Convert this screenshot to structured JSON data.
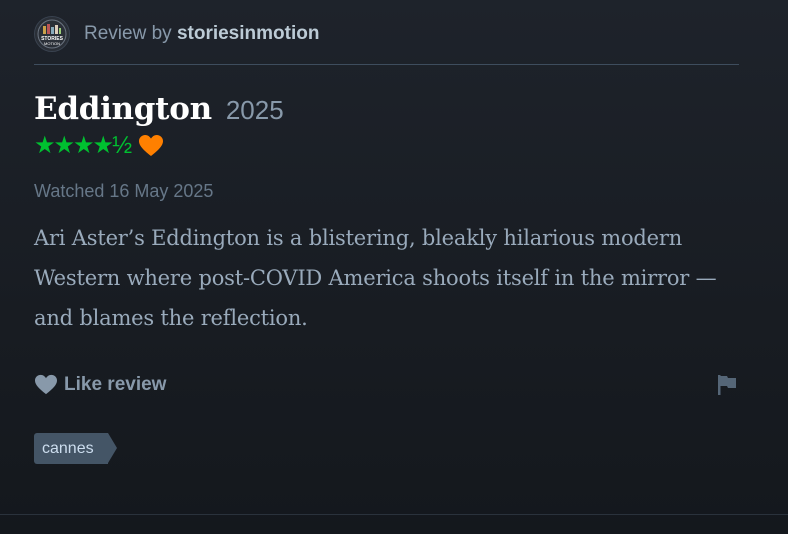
{
  "byline": {
    "prefix": "Review by",
    "username": "storiesinmotion",
    "avatar_text": "STORIES IN MOTION"
  },
  "film": {
    "title": "Eddington",
    "year": "2025"
  },
  "rating": {
    "stars": 4.5,
    "display": "★★★★½",
    "liked": true,
    "star_color": "#00c030",
    "heart_color": "#ff8000"
  },
  "watched": "Watched 16 May 2025",
  "review_text": "Ari Aster’s Eddington is a blistering, bleakly hilarious modern Western where post-COVID America shoots itself in the mirror — and blames the reflection.",
  "actions": {
    "like_label": "Like review",
    "like_icon": "heart-icon",
    "report_icon": "flag-icon"
  },
  "tags": [
    "cannes"
  ]
}
